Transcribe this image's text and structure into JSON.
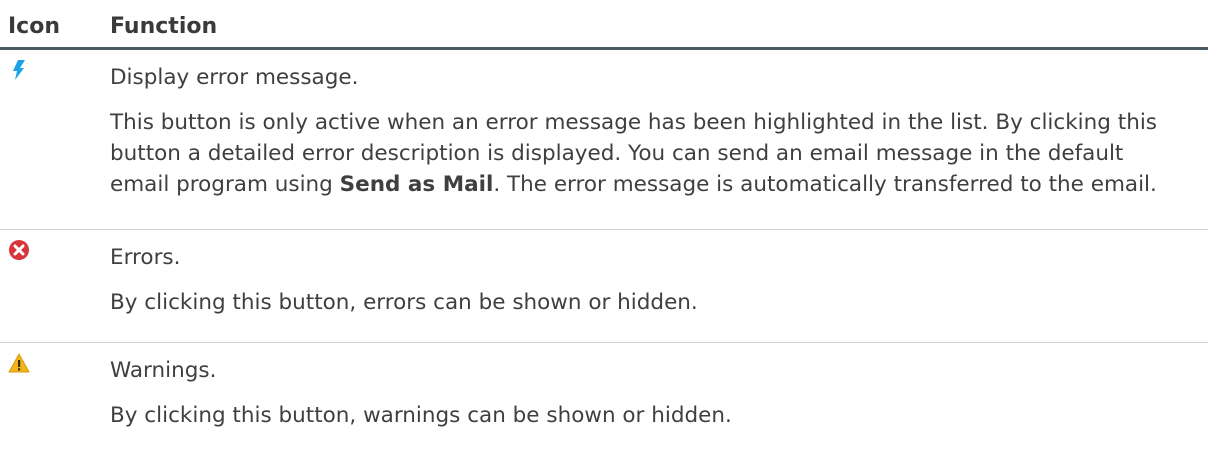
{
  "header": {
    "icon_col": "Icon",
    "function_col": "Function"
  },
  "rows": [
    {
      "icon": "lightning-bolt-icon",
      "icon_color": "#1aa3e8",
      "title": "Display error message.",
      "desc_part1": "This button is only active when an error message has been highlighted in the list. By clicking this button a detailed error description is displayed. You can send an email message in the default email program using ",
      "desc_bold": "Send as Mail",
      "desc_part2": ". The error message is automatically transferred to the email."
    },
    {
      "icon": "error-circle-icon",
      "icon_color": "#d8343b",
      "title": "Errors.",
      "desc": "By clicking this button, errors can be shown or hidden."
    },
    {
      "icon": "warning-triangle-icon",
      "icon_color": "#f1b51c",
      "title": "Warnings.",
      "desc": "By clicking this button, warnings can be shown or hidden."
    }
  ]
}
